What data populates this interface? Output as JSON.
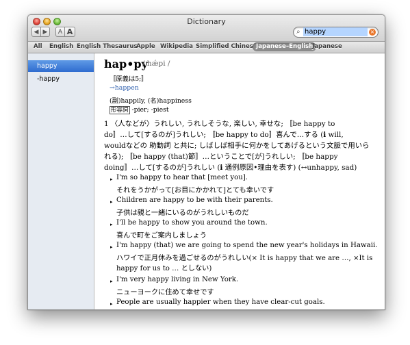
{
  "window": {
    "title": "Dictionary"
  },
  "toolbar": {
    "back": "◀",
    "forward": "▶",
    "font_smaller": "A",
    "font_larger": "A"
  },
  "search": {
    "value": "happy",
    "icon": "magnifier-icon",
    "clear": "×"
  },
  "scopes": [
    {
      "label": "All",
      "active": false
    },
    {
      "label": "English",
      "active": false
    },
    {
      "label": "English Thesaurus",
      "active": false
    },
    {
      "label": "Apple",
      "active": false
    },
    {
      "label": "Wikipedia",
      "active": false
    },
    {
      "label": "Simplified Chinese",
      "active": false
    },
    {
      "label": "Japanese–English",
      "active": true
    },
    {
      "label": "Japanese",
      "active": false
    }
  ],
  "sidebar": {
    "items": [
      {
        "label": "happy",
        "selected": true
      },
      {
        "label": "-happy",
        "selected": false
      }
    ]
  },
  "entry": {
    "headword": "hap•py",
    "pronunciation": "/ hǽpi /",
    "origin": "〚原義は5;〛",
    "see_also": "→happen",
    "derived": "(副)happily, (名)happiness",
    "inflection_tag": "形容詞",
    "inflection_text": "-pier; -piest",
    "def_lines": [
      "1 〈人などが〉うれしい, うれしそうな, 楽しい, 幸せな; 〚be happy to",
      "do〛…して[するのが]うれしい; 〚be happy to do〛喜んで…する (ℹ will,",
      "wouldなどの 助動詞 と共に; しばしば相手に何かをしてあげるという文脈で用いら",
      "れる); 〚be happy (that)節〛…ということで[が]うれしい; 〚be happy",
      "doing〛…して[するのが]うれしい (ℹ 通例原因•理由を表す) (↔unhappy, sad)"
    ],
    "examples": [
      {
        "en": "I'm so happy to hear that [meet you].",
        "ja": "それをうかがって[お目にかかれて]とても幸いです"
      },
      {
        "en": "Children are happy to be with their parents.",
        "ja": "子供は親と一緒にいるのがうれしいものだ"
      },
      {
        "en": "I'll be happy to show you around the town.",
        "ja": "喜んで町をご案内しましょう"
      },
      {
        "en": "I'm happy (that) we are going to spend the new year's holidays in Hawaii.",
        "ja": "ハワイで正月休みを過ごせるのがうれしい(× It is happy that we are …, ×It is",
        "ja2": "happy for us to … としない)"
      },
      {
        "en": "I'm very happy living in New York.",
        "ja": "ニューヨークに住めて幸せです"
      },
      {
        "en": "People are usually happier when they have clear-cut goals."
      }
    ]
  }
}
